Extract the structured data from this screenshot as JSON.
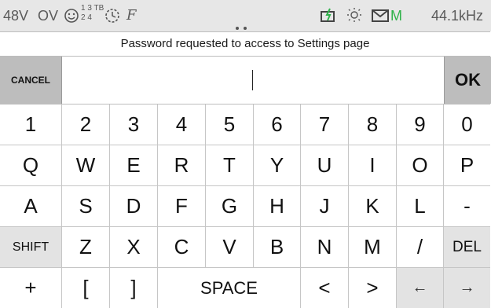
{
  "status_bar": {
    "phantom": "48V",
    "mode": "OV",
    "tracks_top": "1 3 TB",
    "tracks_bottom": "2 4",
    "script_icon": "F",
    "sample_rate": "44.1kHz",
    "m_indicator": "M",
    "m_color": "#2fb24a"
  },
  "dialog": {
    "title": "Password requested to access to Settings page",
    "cancel_label": "CANCEL",
    "ok_label": "OK",
    "password_value": ""
  },
  "keyboard": {
    "row1": [
      "1",
      "2",
      "3",
      "4",
      "5",
      "6",
      "7",
      "8",
      "9",
      "0"
    ],
    "row2": [
      "Q",
      "W",
      "E",
      "R",
      "T",
      "Y",
      "U",
      "I",
      "O",
      "P"
    ],
    "row3": [
      "A",
      "S",
      "D",
      "F",
      "G",
      "H",
      "J",
      "K",
      "L",
      "-"
    ],
    "row4": [
      "SHIFT",
      "Z",
      "X",
      "C",
      "V",
      "B",
      "N",
      "M",
      "/",
      "DEL"
    ],
    "row5": [
      "+",
      "[",
      "]",
      "SPACE",
      "<",
      ">",
      "←",
      "→"
    ]
  }
}
